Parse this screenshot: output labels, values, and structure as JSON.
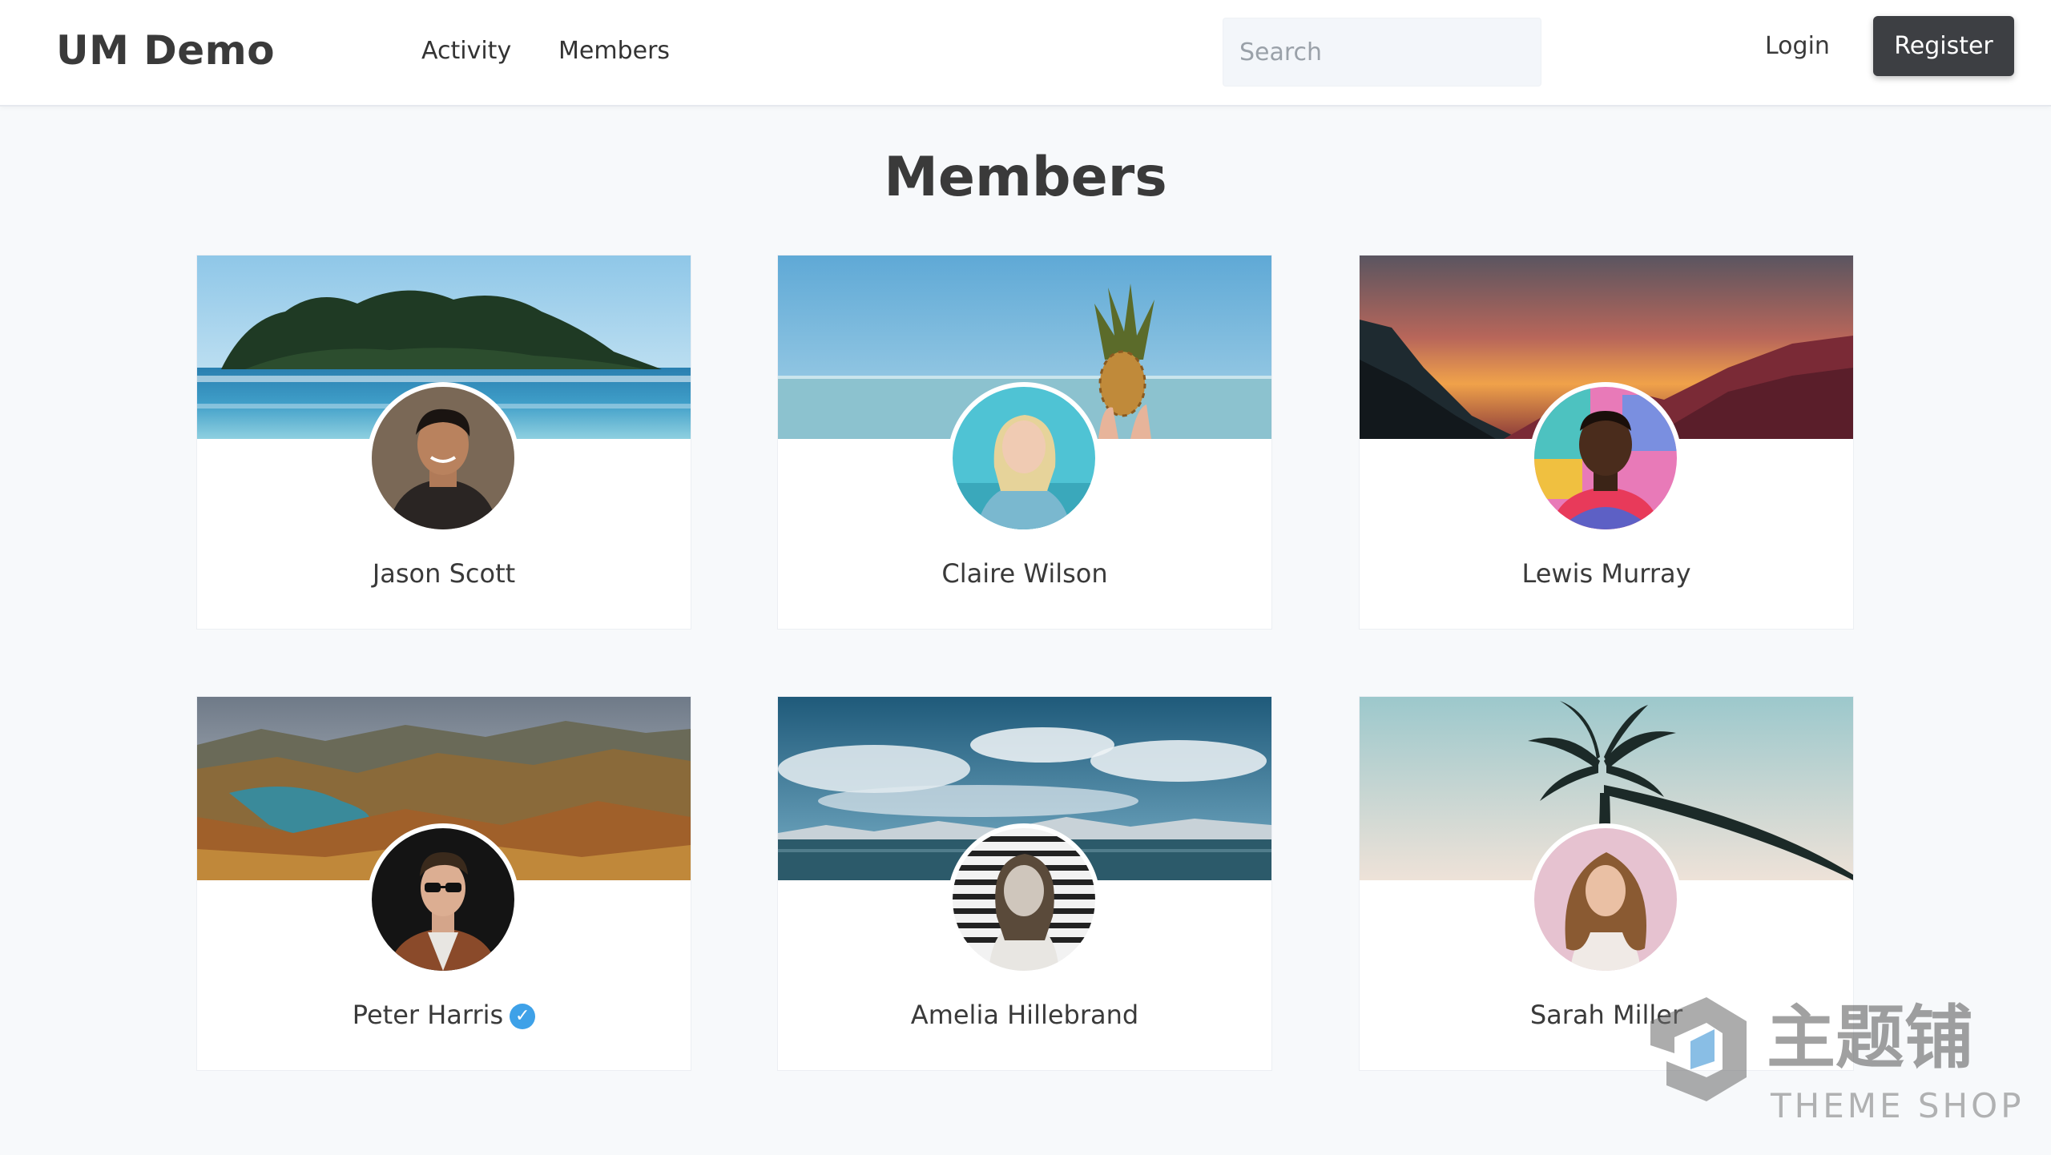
{
  "header": {
    "brand": "UM Demo",
    "nav": [
      "Activity",
      "Members"
    ],
    "search_placeholder": "Search",
    "login_label": "Login",
    "register_label": "Register"
  },
  "page_title": "Members",
  "members": [
    {
      "name": "Jason Scott",
      "verified": false
    },
    {
      "name": "Claire Wilson",
      "verified": false
    },
    {
      "name": "Lewis Murray",
      "verified": false
    },
    {
      "name": "Peter Harris",
      "verified": true
    },
    {
      "name": "Amelia Hillebrand",
      "verified": false
    },
    {
      "name": "Sarah Miller",
      "verified": false
    }
  ],
  "watermark": {
    "logo_text": "主题铺",
    "sub_text": "THEME SHOP"
  },
  "colors": {
    "page_bg": "#f7f9fb",
    "register_bg": "#3d3f43",
    "verified": "#3ea1e8"
  }
}
